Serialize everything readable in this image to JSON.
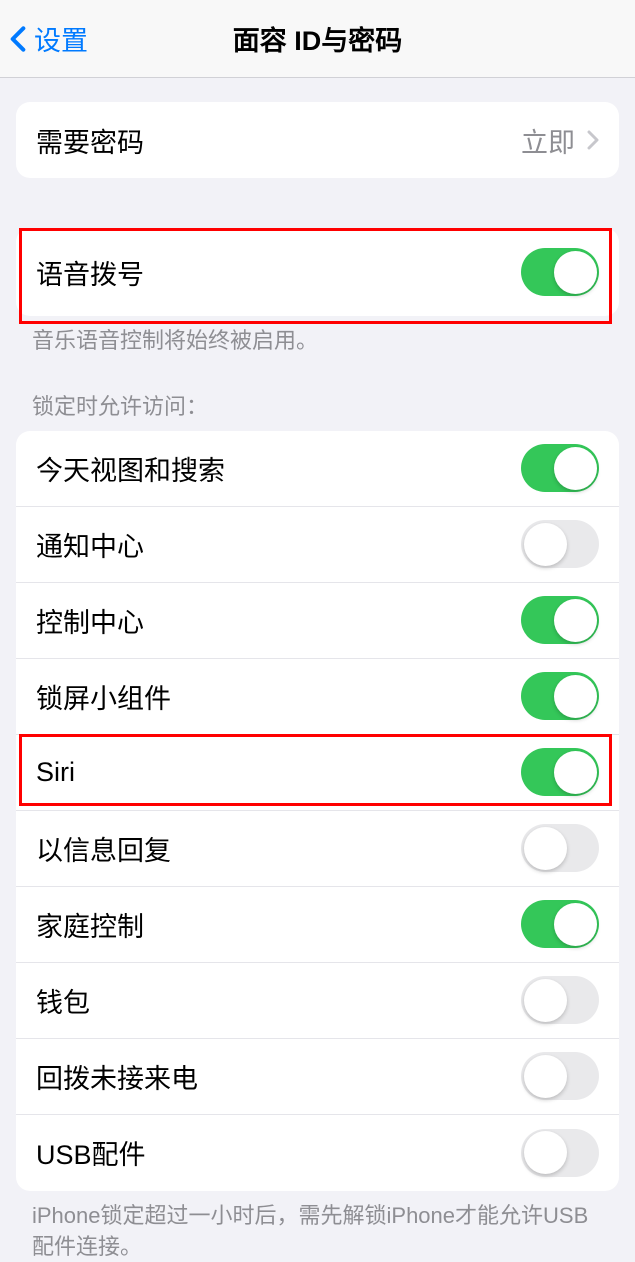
{
  "header": {
    "back_label": "设置",
    "title": "面容 ID与密码"
  },
  "require_passcode": {
    "label": "需要密码",
    "value": "立即"
  },
  "voice_dial": {
    "label": "语音拨号",
    "footer": "音乐语音控制将始终被启用。"
  },
  "lock_section": {
    "header": "锁定时允许访问：",
    "items": [
      {
        "label": "今天视图和搜索",
        "on": true
      },
      {
        "label": "通知中心",
        "on": false
      },
      {
        "label": "控制中心",
        "on": true
      },
      {
        "label": "锁屏小组件",
        "on": true
      },
      {
        "label": "Siri",
        "on": true
      },
      {
        "label": "以信息回复",
        "on": false
      },
      {
        "label": "家庭控制",
        "on": true
      },
      {
        "label": "钱包",
        "on": false
      },
      {
        "label": "回拨未接来电",
        "on": false
      },
      {
        "label": "USB配件",
        "on": false
      }
    ],
    "footer": "iPhone锁定超过一小时后，需先解锁iPhone才能允许USB配件连接。"
  }
}
